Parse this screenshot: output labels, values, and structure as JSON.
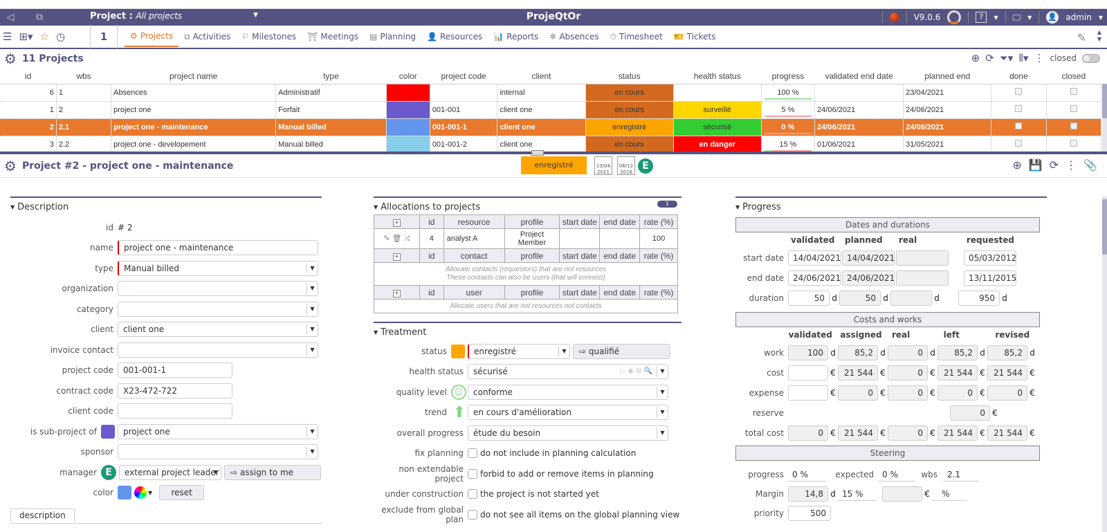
{
  "header": {
    "project_label": "Project :",
    "project_value": "All projects",
    "app_title": "ProjeQtOr",
    "version": "V9.0.6",
    "help": "?",
    "user": "admin"
  },
  "menu": {
    "counter": "1",
    "items": [
      {
        "label": "Projects",
        "icon": "gear-icon",
        "active": true
      },
      {
        "label": "Activities",
        "icon": "activities-icon"
      },
      {
        "label": "Milestones",
        "icon": "flag-icon"
      },
      {
        "label": "Meetings",
        "icon": "meetings-icon"
      },
      {
        "label": "Planning",
        "icon": "planning-icon"
      },
      {
        "label": "Resources",
        "icon": "person-icon"
      },
      {
        "label": "Reports",
        "icon": "reports-icon"
      },
      {
        "label": "Absences",
        "icon": "absences-icon"
      },
      {
        "label": "Timesheet",
        "icon": "stopwatch-icon"
      },
      {
        "label": "Tickets",
        "icon": "ticket-icon"
      }
    ]
  },
  "list": {
    "title": "11 Projects",
    "closed_label": "closed",
    "columns": [
      "id",
      "wbs",
      "project name",
      "type",
      "color",
      "project code",
      "client",
      "status",
      "health status",
      "progress",
      "validated end date",
      "planned end",
      "done",
      "closed"
    ],
    "rows": [
      {
        "id": "6",
        "wbs": "1",
        "name": "Absences",
        "type": "Administratif",
        "color": "#ff0000",
        "code": "",
        "client": "internal",
        "status": "en cours",
        "status_color": "#d2691e",
        "health": "",
        "health_color": "",
        "progress": "100 %",
        "progress_value": 100,
        "validated_end": "",
        "planned_end": "23/04/2021",
        "selected": false
      },
      {
        "id": "1",
        "wbs": "2",
        "name": "project one",
        "type": "Forfait",
        "color": "#6a5acd",
        "code": "001-001",
        "client": "client one",
        "status": "en cours",
        "status_color": "#d2691e",
        "health": "surveillé",
        "health_color": "#ffd700",
        "progress": "5 %",
        "progress_value": 5,
        "validated_end": "24/06/2021",
        "planned_end": "24/06/2021",
        "selected": false
      },
      {
        "id": "2",
        "wbs": "2.1",
        "name": "project one - maintenance",
        "type": "Manual billed",
        "color": "#6495ed",
        "code": "001-001-1",
        "client": "client one",
        "status": "enregistré",
        "status_color": "#ffa500",
        "health": "sécurisé",
        "health_color": "#32cd32",
        "progress": "0 %",
        "progress_value": 0,
        "validated_end": "24/06/2021",
        "planned_end": "24/06/2021",
        "selected": true
      },
      {
        "id": "3",
        "wbs": "2.2",
        "name": "project one - developement",
        "type": "Manual billed",
        "color": "#87ceeb",
        "code": "001-001-2",
        "client": "client one",
        "status": "en cours",
        "status_color": "#d2691e",
        "health": "en danger",
        "health_color": "#ff0000",
        "progress": "15 %",
        "progress_value": 15,
        "validated_end": "01/06/2021",
        "planned_end": "31/05/2021",
        "selected": false
      }
    ]
  },
  "detail": {
    "title": "Project  #2  - project one - maintenance",
    "status_badge": "enregistré",
    "status_color": "#ffa500",
    "cal1": "13/04 2021",
    "cal2": "06/12 2018",
    "e_badge": "E"
  },
  "description": {
    "section_title": "Description",
    "fields": {
      "id_label": "id",
      "id_value": "#  2",
      "name_label": "name",
      "name_value": "project one - maintenance",
      "type_label": "type",
      "type_value": "Manual billed",
      "organization_label": "organization",
      "organization_value": "",
      "category_label": "category",
      "category_value": "",
      "client_label": "client",
      "client_value": "client one",
      "invoice_contact_label": "invoice contact",
      "invoice_contact_value": "",
      "project_code_label": "project code",
      "project_code_value": "001-001-1",
      "contract_code_label": "contract code",
      "contract_code_value": "X23-472-722",
      "client_code_label": "client code",
      "client_code_value": "",
      "sub_project_label": "is sub-project of",
      "sub_project_value": "project one",
      "sub_project_color": "#6a5acd",
      "sponsor_label": "sponsor",
      "sponsor_value": "",
      "manager_label": "manager",
      "manager_value": "external project leader",
      "assign_label": "assign to me",
      "color_label": "color",
      "color_value": "#6495ed",
      "reset_label": "reset"
    },
    "tab_description": "description"
  },
  "allocations": {
    "section_title": "Allocations to projects",
    "count": "1",
    "resource_headers": [
      "id",
      "resource",
      "profile",
      "start date",
      "end date",
      "rate (%)"
    ],
    "resource_rows": [
      {
        "id": "4",
        "resource": "analyst A",
        "profile": "Project Member",
        "start": "",
        "end": "",
        "rate": "100"
      }
    ],
    "contact_headers": [
      "id",
      "contact",
      "profile",
      "start date",
      "end date",
      "rate (%)"
    ],
    "contact_msg_1": "Allocate contacts (requestors) that are not resources",
    "contact_msg_2": "These contacts can also be users (that will connect)",
    "user_headers": [
      "id",
      "user",
      "profile",
      "start date",
      "end date",
      "rate (%)"
    ],
    "user_msg": "Allocate users that are not resources not contacts"
  },
  "treatment": {
    "section_title": "Treatment",
    "status_label": "status",
    "status_value": "enregistré",
    "status_color": "#ffa500",
    "next_status": "qualifié",
    "health_label": "health status",
    "health_value": "sécurisé",
    "quality_label": "quality level",
    "quality_value": "conforme",
    "trend_label": "trend",
    "trend_value": "en cours d'amélioration",
    "overall_label": "overall progress",
    "overall_value": "étude du besoin",
    "fix_label": "fix planning",
    "fix_text": "do not include in planning calculation",
    "nonext_label": "non extendable project",
    "nonext_text": "forbid to add or remove items in planning",
    "under_label": "under construction",
    "under_text": "the project is not started yet",
    "exclude_label": "exclude from global plan",
    "exclude_text": "do not see all items on the global planning view"
  },
  "progress": {
    "section_title": "Progress",
    "dates_title": "Dates and durations",
    "dates_cols": [
      "validated",
      "planned",
      "real",
      "requested"
    ],
    "start_label": "start date",
    "start": [
      "14/04/2021",
      "14/04/2021",
      "",
      "05/03/2012"
    ],
    "end_label": "end date",
    "end": [
      "24/06/2021",
      "24/06/2021",
      "",
      "13/11/2015"
    ],
    "duration_label": "duration",
    "duration": [
      "50",
      "50",
      "",
      "950"
    ],
    "day_unit": "d",
    "costs_title": "Costs and works",
    "costs_cols": [
      "validated",
      "assigned",
      "real",
      "left",
      "revised"
    ],
    "work_label": "work",
    "work": [
      "100",
      "85,2",
      "0",
      "85,2",
      "85,2"
    ],
    "cost_label": "cost",
    "cost": [
      "",
      "21 544",
      "0",
      "21 544",
      "21 544"
    ],
    "expense_label": "expense",
    "expense": [
      "",
      "0",
      "0",
      "0",
      "0"
    ],
    "reserve_label": "reserve",
    "reserve": "0",
    "total_label": "total cost",
    "total": [
      "0",
      "21 544",
      "0",
      "21 544",
      "21 544"
    ],
    "euro": "€",
    "steering_title": "Steering",
    "progress_label": "progress",
    "progress_value": "0 %",
    "expected_label": "expected",
    "expected_value": "0 %",
    "wbs_label": "wbs",
    "wbs_value": "2.1",
    "margin_label": "Margin",
    "margin_days": "14,8",
    "margin_pct": "15 %",
    "margin_cost": "",
    "margin_cost_pct": "%",
    "priority_label": "priority",
    "priority_value": "500"
  }
}
